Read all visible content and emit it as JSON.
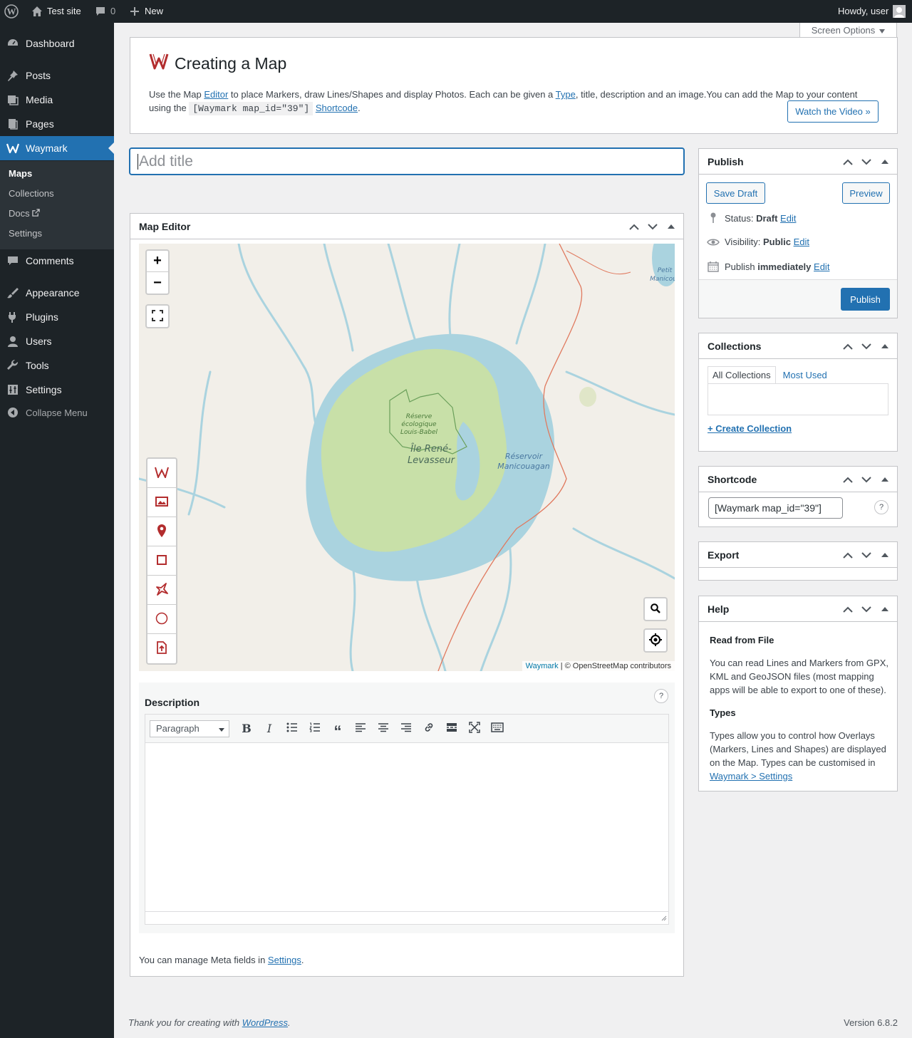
{
  "adminbar": {
    "site_name": "Test site",
    "comments_count": "0",
    "new_label": "New",
    "greeting": "Howdy, user"
  },
  "sidebar": {
    "items": [
      {
        "label": "Dashboard",
        "icon": "dashboard-icon"
      },
      {
        "label": "Posts",
        "icon": "pin-icon"
      },
      {
        "label": "Media",
        "icon": "media-icon"
      },
      {
        "label": "Pages",
        "icon": "pages-icon"
      },
      {
        "label": "Waymark",
        "icon": "waymark-icon"
      },
      {
        "label": "Comments",
        "icon": "comment-icon"
      },
      {
        "label": "Appearance",
        "icon": "brush-icon"
      },
      {
        "label": "Plugins",
        "icon": "plug-icon"
      },
      {
        "label": "Users",
        "icon": "user-icon"
      },
      {
        "label": "Tools",
        "icon": "wrench-icon"
      },
      {
        "label": "Settings",
        "icon": "sliders-icon"
      }
    ],
    "submenu": [
      "Maps",
      "Collections",
      "Docs",
      "Settings"
    ],
    "collapse_label": "Collapse Menu"
  },
  "screen_options": "Screen Options",
  "header": {
    "title": "Creating a Map",
    "intro_1": "Use the Map ",
    "editor_link": "Editor",
    "intro_2": " to place Markers, draw Lines/Shapes and display Photos. Each can be given a ",
    "type_link": "Type",
    "intro_3": ", title, description and an image.You can add the Map to your content using the ",
    "shortcode_code": "[Waymark map_id=\"39\"]",
    "shortcode_link": "Shortcode",
    "intro_4": ".",
    "video_button": "Watch the Video »"
  },
  "title_placeholder": "Add title",
  "map_editor": {
    "heading": "Map Editor",
    "map_labels": {
      "reserve": [
        "Réserve",
        "écologique",
        "Louis-Babel"
      ],
      "island": [
        "Île René-",
        "Levasseur"
      ],
      "reservoir": [
        "Réservoir",
        "Manicouagan"
      ],
      "petit": [
        "Petit",
        "Manicou"
      ]
    },
    "zoom_in": "+",
    "zoom_out": "−",
    "attribution_link": "Waymark",
    "attribution_text": " | © OpenStreetMap contributors",
    "tools": [
      "waymark-icon",
      "image-icon",
      "marker-icon",
      "rectangle-icon",
      "polygon-icon",
      "circle-icon",
      "upload-icon"
    ],
    "description_label": "Description",
    "help_char": "?",
    "format_select": "Paragraph",
    "meta_note_1": "You can manage Meta fields in ",
    "meta_note_link": "Settings",
    "meta_note_2": "."
  },
  "publish": {
    "heading": "Publish",
    "save_draft": "Save Draft",
    "preview": "Preview",
    "status_label": "Status: ",
    "status_value": "Draft",
    "visibility_label": "Visibility: ",
    "visibility_value": "Public",
    "publish_label": "Publish ",
    "publish_value": "immediately",
    "edit": "Edit",
    "publish_button": "Publish"
  },
  "collections": {
    "heading": "Collections",
    "tab_all": "All Collections",
    "tab_used": "Most Used",
    "create_link": "+ Create Collection"
  },
  "shortcode": {
    "heading": "Shortcode",
    "value": "[Waymark map_id=\"39\"]",
    "help": "?"
  },
  "export": {
    "heading": "Export"
  },
  "help": {
    "heading": "Help",
    "h1": "Read from File",
    "p1": "You can read Lines and Markers from GPX, KML and GeoJSON files (most mapping apps will be able to export to one of these).",
    "h2": "Types",
    "p2": "Types allow you to control how Overlays (Markers, Lines and Shapes) are displayed on the Map. Types can be customised in ",
    "p2_link": "Waymark > Settings"
  },
  "footer": {
    "thanks": "Thank you for creating with ",
    "wp_link": "WordPress",
    "thanks_end": ".",
    "version": "Version 6.8.2"
  },
  "colors": {
    "adminbar_bg": "#1d2327",
    "accent": "#2271b1",
    "waymark_red": "#b32d2e",
    "map_water": "#aad3df",
    "map_land": "#f2efe9",
    "map_green": "#c8e0a8"
  }
}
